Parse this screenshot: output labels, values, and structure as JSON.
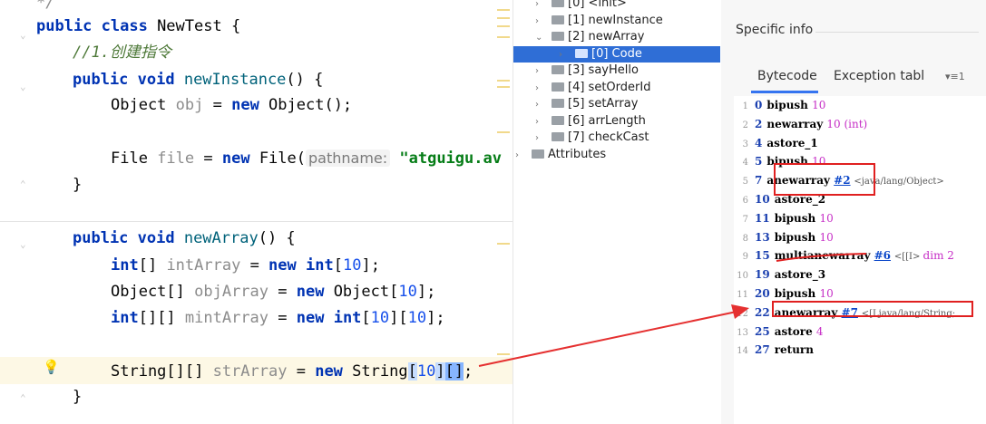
{
  "editor": {
    "lines": [
      {
        "id": "l0"
      },
      {
        "kw1": "public class ",
        "cls": "NewTest",
        "rest": " {"
      },
      {
        "comment": "//1.创建指令"
      },
      {
        "kw1": "public void ",
        "fn": "newInstance",
        "rest": "() {"
      },
      {
        "type": "Object ",
        "var": "obj",
        "eq": " = ",
        "kw2": "new ",
        "tail": "Object();"
      },
      {
        "type": "File ",
        "var": "file",
        "eq": " = ",
        "kw2": "new ",
        "tail": "File(",
        "hint": "pathname:",
        "str": " \"atguigu.av"
      },
      {
        "brace": "}"
      },
      {
        "kw1": "public void ",
        "fn": "newArray",
        "rest": "() {"
      },
      {
        "kw1": "int",
        "rest1": "[] ",
        "var": "intArray",
        "eq": " = ",
        "kw2": "new ",
        "kw3": "int",
        "b1": "[",
        "n": "10",
        "b2": "];"
      },
      {
        "type": "Object[] ",
        "var": "objArray",
        "eq": " = ",
        "kw2": "new ",
        "tail": "Object[",
        "n": "10",
        "b2": "];"
      },
      {
        "kw1": "int",
        "rest1": "[][] ",
        "var": "mintArray",
        "eq": " = ",
        "kw2": "new ",
        "kw3": "int",
        "b1": "[",
        "n": "10",
        "b2": "][",
        "n2": "10",
        "b3": "];"
      },
      {
        "type": "String[][] ",
        "var": "strArray",
        "eq": " = ",
        "kw2": "new ",
        "tail": "String",
        "b1": "[",
        "n": "10",
        "b2": "]",
        "b3": "[]",
        "b4": ";"
      },
      {
        "brace": "}"
      }
    ]
  },
  "tree": {
    "items": [
      {
        "label": "[0] <init>",
        "arrow": "›",
        "indent": 1
      },
      {
        "label": "[1] newInstance",
        "arrow": "›",
        "indent": 1
      },
      {
        "label": "[2] newArray",
        "arrow": "⌄",
        "indent": 1
      },
      {
        "label": "[0] Code",
        "arrow": "›",
        "indent": 2,
        "selected": true
      },
      {
        "label": "[3] sayHello",
        "arrow": "›",
        "indent": 1
      },
      {
        "label": "[4] setOrderId",
        "arrow": "›",
        "indent": 1
      },
      {
        "label": "[5] setArray",
        "arrow": "›",
        "indent": 1
      },
      {
        "label": "[6] arrLength",
        "arrow": "›",
        "indent": 1
      },
      {
        "label": "[7] checkCast",
        "arrow": "›",
        "indent": 1
      },
      {
        "label": "Attributes",
        "arrow": "›",
        "indent": 0
      }
    ]
  },
  "panel": {
    "title": "Specific info",
    "tabs": [
      "Bytecode",
      "Exception tabl"
    ],
    "more": "▾≡1",
    "bytecode": [
      {
        "ln": "1",
        "off": "0",
        "op": "bipush",
        "arg": "10"
      },
      {
        "ln": "2",
        "off": "2",
        "op": "newarray",
        "arg": "10 (int)"
      },
      {
        "ln": "3",
        "off": "4",
        "op": "astore_1"
      },
      {
        "ln": "4",
        "off": "5",
        "op": "bipush",
        "arg": "10"
      },
      {
        "ln": "5",
        "off": "7",
        "op": "anewarray",
        "ref": "#2",
        "cmt": "<java/lang/Object>"
      },
      {
        "ln": "6",
        "off": "10",
        "op": "astore_2"
      },
      {
        "ln": "7",
        "off": "11",
        "op": "bipush",
        "arg": "10"
      },
      {
        "ln": "8",
        "off": "13",
        "op": "bipush",
        "arg": "10"
      },
      {
        "ln": "9",
        "off": "15",
        "op": "multianewarray",
        "ref": "#6",
        "cmt": "<[[I>",
        "arg": "dim 2"
      },
      {
        "ln": "10",
        "off": "19",
        "op": "astore_3"
      },
      {
        "ln": "11",
        "off": "20",
        "op": "bipush",
        "arg": "10"
      },
      {
        "ln": "12",
        "off": "22",
        "op": "anewarray",
        "ref": "#7",
        "cmt": "<[Ljava/lang/String;"
      },
      {
        "ln": "13",
        "off": "25",
        "op": "astore",
        "arg": "4"
      },
      {
        "ln": "14",
        "off": "27",
        "op": "return"
      }
    ]
  },
  "colors": {
    "annotation": "#e02020",
    "selection": "#2f6ed6",
    "tab_accent": "#3574f0"
  }
}
